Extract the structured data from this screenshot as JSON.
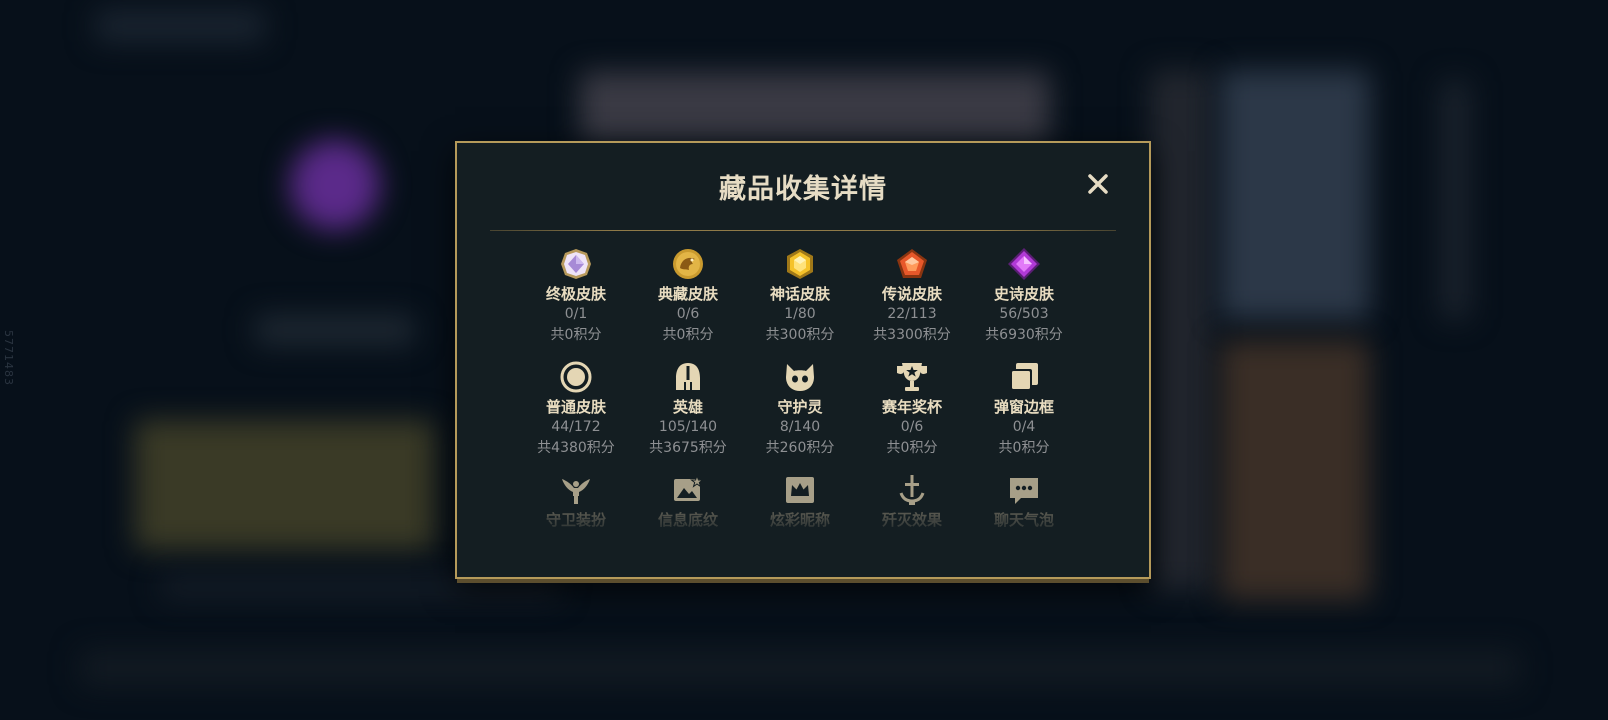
{
  "side_id": "5771483",
  "modal": {
    "title": "藏品收集详情",
    "close_label": "×"
  },
  "items": [
    {
      "name": "终极皮肤",
      "count": "0/1",
      "points": "共0积分",
      "icon": "ultimate-gem-icon"
    },
    {
      "name": "典藏皮肤",
      "count": "0/6",
      "points": "共0积分",
      "icon": "dragon-emblem-icon"
    },
    {
      "name": "神话皮肤",
      "count": "1/80",
      "points": "共300积分",
      "icon": "mythic-gem-icon"
    },
    {
      "name": "传说皮肤",
      "count": "22/113",
      "points": "共3300积分",
      "icon": "legendary-gem-icon"
    },
    {
      "name": "史诗皮肤",
      "count": "56/503",
      "points": "共6930积分",
      "icon": "epic-gem-icon"
    },
    {
      "name": "普通皮肤",
      "count": "44/172",
      "points": "共4380积分",
      "icon": "ring-icon"
    },
    {
      "name": "英雄",
      "count": "105/140",
      "points": "共3675积分",
      "icon": "helmet-icon"
    },
    {
      "name": "守护灵",
      "count": "8/140",
      "points": "共260积分",
      "icon": "companion-icon"
    },
    {
      "name": "赛年奖杯",
      "count": "0/6",
      "points": "共0积分",
      "icon": "trophy-icon"
    },
    {
      "name": "弹窗边框",
      "count": "0/4",
      "points": "共0积分",
      "icon": "frames-icon"
    },
    {
      "name": "守卫装扮",
      "icon": "ward-icon"
    },
    {
      "name": "信息底纹",
      "icon": "banner-icon"
    },
    {
      "name": "炫彩昵称",
      "icon": "crown-card-icon"
    },
    {
      "name": "歼灭效果",
      "icon": "sword-icon"
    },
    {
      "name": "聊天气泡",
      "icon": "chat-bubble-icon"
    }
  ],
  "colors": {
    "accent_gold": "#b59a5a",
    "title_text": "#e6dcc4",
    "muted_text": "#8e9093",
    "panel_bg": "#141e22"
  }
}
